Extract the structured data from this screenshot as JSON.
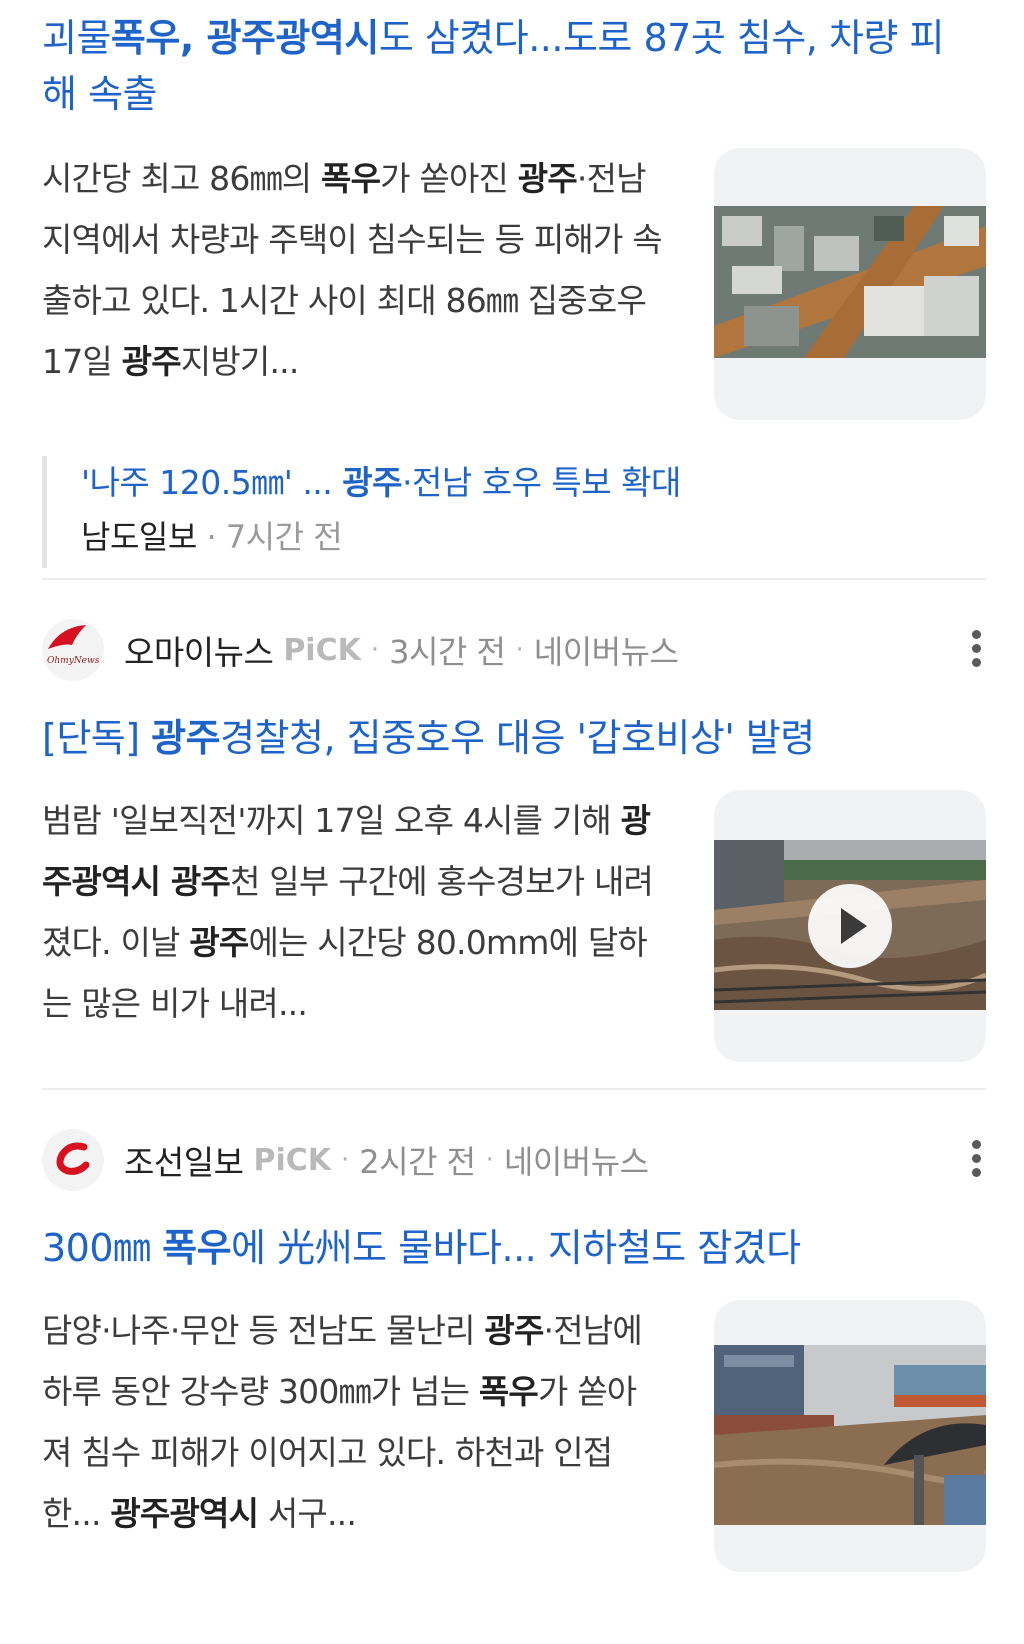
{
  "article1": {
    "headline_parts": [
      {
        "text": "괴물",
        "bold": false
      },
      {
        "text": "폭우, 광주광역시",
        "bold": true
      },
      {
        "text": "도 삼켰다...도로 87곳 침수, 차량 피해 속출",
        "bold": false
      }
    ],
    "snippet_parts": [
      {
        "text": "시간당 최고 86㎜의 ",
        "bold": false
      },
      {
        "text": "폭우",
        "bold": true
      },
      {
        "text": "가 쏟아진 ",
        "bold": false
      },
      {
        "text": "광주",
        "bold": true
      },
      {
        "text": "·전남 지역에서 차량과 주택이 침수되는 등 피해가 속출하고 있다. 1시간 사이 최대 86㎜ 집중호우 17일 ",
        "bold": false
      },
      {
        "text": "광주",
        "bold": true
      },
      {
        "text": "지방기...",
        "bold": false
      }
    ],
    "thumbnail_icon": "aerial-flooded-city-photo",
    "related": {
      "title_parts": [
        {
          "text": "'나주 120.5㎜' ... ",
          "bold": false
        },
        {
          "text": "광주",
          "bold": true
        },
        {
          "text": "·전남 호우 특보 확대",
          "bold": false
        }
      ],
      "source": "남도일보",
      "time": "7시간 전"
    }
  },
  "article2": {
    "source": "오마이뉴스",
    "pick": "PiCK",
    "time": "3시간 전",
    "platform": "네이버뉴스",
    "logo_text": "OhmyNews",
    "headline_parts": [
      {
        "text": "[단독] ",
        "bold": false
      },
      {
        "text": "광주",
        "bold": true
      },
      {
        "text": "경찰청, 집중호우 대응 '갑호비상' 발령",
        "bold": false
      }
    ],
    "snippet_parts": [
      {
        "text": "범람 '일보직전'까지 17일 오후 4시를 기해 ",
        "bold": false
      },
      {
        "text": "광주광역시 광주",
        "bold": true
      },
      {
        "text": "천 일부 구간에 홍수경보가 내려졌다. 이날 ",
        "bold": false
      },
      {
        "text": "광주",
        "bold": true
      },
      {
        "text": "에는 시간당 80.0mm에 달하는 많은 비가 내려...",
        "bold": false
      }
    ],
    "thumbnail_icon": "flooded-river-video-photo"
  },
  "article3": {
    "source": "조선일보",
    "pick": "PiCK",
    "time": "2시간 전",
    "platform": "네이버뉴스",
    "headline_parts": [
      {
        "text": "300㎜ ",
        "bold": false
      },
      {
        "text": "폭우",
        "bold": true
      },
      {
        "text": "에 光州도 물바다... 지하철도 잠겼다",
        "bold": false
      }
    ],
    "snippet_parts": [
      {
        "text": "담양·나주·무안 등 전남도 물난리 ",
        "bold": false
      },
      {
        "text": "광주",
        "bold": true
      },
      {
        "text": "·전남에 하루 동안 강수량 300㎜가 넘는 ",
        "bold": false
      },
      {
        "text": "폭우",
        "bold": true
      },
      {
        "text": "가 쏟아져 침수 피해가 이어지고 있다. 하천과 인접한... ",
        "bold": false
      },
      {
        "text": "광주광역시",
        "bold": true
      },
      {
        "text": " 서구...",
        "bold": false
      }
    ],
    "thumbnail_icon": "flooded-street-umbrella-photo"
  },
  "colors": {
    "headline": "#1e63c9",
    "snippet": "#3c3c3c",
    "meta": "#8f8f8f",
    "pick": "#b9b9b9",
    "divider": "#ececec",
    "logo_red": "#d6101e"
  }
}
